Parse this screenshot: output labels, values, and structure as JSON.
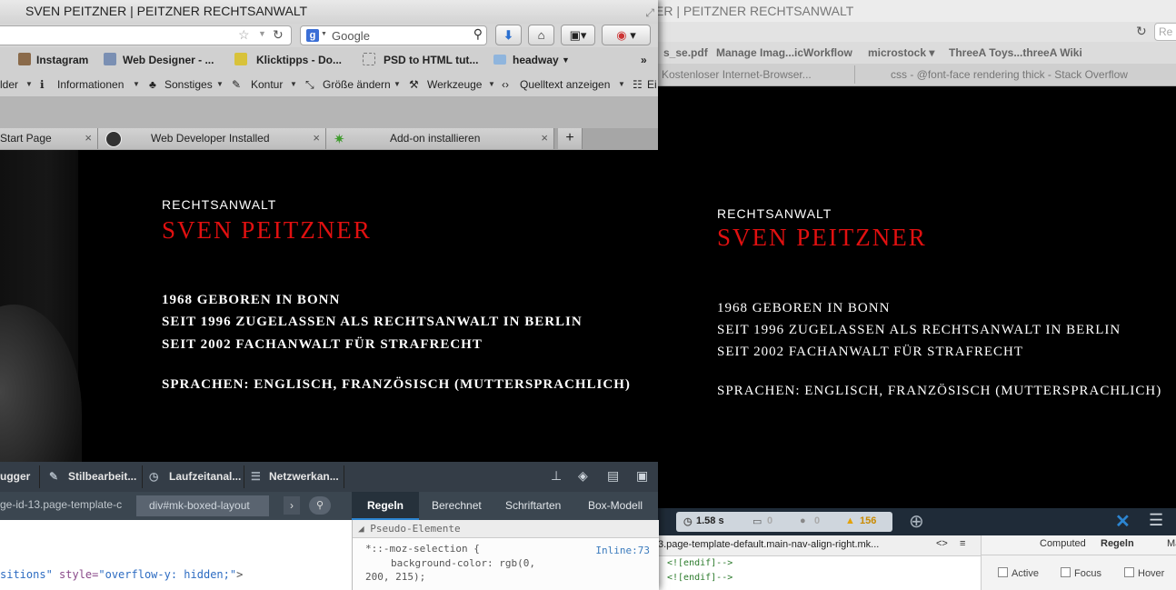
{
  "right_window": {
    "title": "ER | PEITZNER RECHTSANWALT",
    "search_placeholder": "Re",
    "bookmarks": [
      "s_se.pdf",
      "Manage Imag...icWorkflow",
      "microstock ▾",
      "ThreeA Toys...threeA Wiki"
    ],
    "tabs": [
      "Kostenloser Internet-Browser...",
      "css - @font-face rendering thick - Stack Overflow"
    ],
    "content": {
      "subtitle": "RECHTSANWALT",
      "name": "SVEN PEITZNER",
      "lines": [
        "1968 GEBOREN IN BONN",
        "SEIT 1996 ZUGELASSEN ALS RECHTSANWALT IN BERLIN",
        "SEIT 2002 FACHANWALT FÜR STRAFRECHT"
      ],
      "languages": "SPRACHEN: ENGLISCH, FRANZÖSISCH (MUTTERSPRACHLICH)"
    },
    "devtools": {
      "load_time": "1.58 s",
      "messages": "0",
      "errors": "0",
      "warnings": "156",
      "breadcrumb": "3.page-template-default.main-nav-align-right.mk...",
      "source_lines": [
        "<![endif]-->",
        "<![endif]-->"
      ],
      "tabs": [
        "Computed",
        "Regeln",
        "Ma"
      ],
      "states": [
        "Active",
        "Focus",
        "Hover"
      ]
    }
  },
  "left_window": {
    "title": "SVEN PEITZNER | PEITZNER RECHTSANWALT",
    "search_engine_label": "Google",
    "bookmarks": [
      "Instagram",
      "Web Designer - ...",
      "Klicktipps - Do...",
      "PSD to HTML tut...",
      "headway"
    ],
    "tools": [
      "lder",
      "Informationen",
      "Sonstiges",
      "Kontur",
      "Größe ändern",
      "Werkzeuge",
      "Quelltext anzeigen",
      "Ei"
    ],
    "tabs": [
      "Start Page",
      "Web Developer Installed",
      "Add-on installieren"
    ],
    "content": {
      "subtitle": "RECHTSANWALT",
      "name": "SVEN PEITZNER",
      "lines": [
        "1968 GEBOREN IN BONN",
        "SEIT 1996 ZUGELASSEN ALS RECHTSANWALT IN BERLIN",
        "SEIT 2002 FACHANWALT FÜR STRAFRECHT"
      ],
      "languages": "SPRACHEN: ENGLISCH, FRANZÖSISCH (MUTTERSPRACHLICH)"
    },
    "devtools": {
      "toolbar": [
        "ugger",
        "Stilbearbeit...",
        "Laufzeitanal...",
        "Netzwerkan..."
      ],
      "breadcrumb_prev": "ge-id-13.page-template-c",
      "breadcrumb_current": "div#mk-boxed-layout",
      "rule_tabs": [
        "Regeln",
        "Berechnet",
        "Schriftarten",
        "Box-Modell"
      ],
      "markup_line_a": "sitions\"",
      "markup_line_b": " style=",
      "markup_line_c": "\"overflow-y: hidden;\"",
      "markup_line_d": ">",
      "rules_header": "Pseudo-Elemente",
      "rule_selector": "*::-moz-selection {",
      "rule_source": "Inline:73",
      "rule_decl_1": "background-color: rgb(0,",
      "rule_decl_2": "200, 215);"
    }
  },
  "colors": {
    "accent_red": "#e01010",
    "devtools_blue": "#2c85d1",
    "warning": "#e3a20a"
  }
}
